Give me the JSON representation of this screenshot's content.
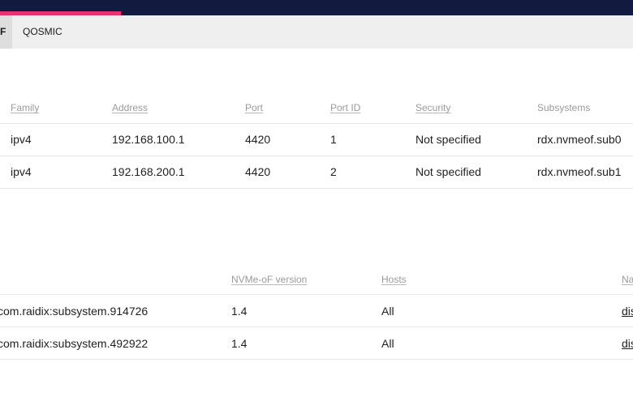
{
  "tabs": {
    "active_label": "F",
    "qos_label": "QOSMIC"
  },
  "ports_table": {
    "headers": [
      "Family",
      "Address",
      "Port",
      "Port ID",
      "Security",
      "Subsystems"
    ],
    "rows": [
      [
        "ipv4",
        "192.168.100.1",
        "4420",
        "1",
        "Not specified",
        "rdx.nvmeof.sub0"
      ],
      [
        "ipv4",
        "192.168.200.1",
        "4420",
        "2",
        "Not specified",
        "rdx.nvmeof.sub1"
      ]
    ]
  },
  "subsystems_table": {
    "headers": [
      "NVMe-oF version",
      "Hosts",
      "Na"
    ],
    "rows": [
      [
        "com.raidix:subsystem.914726",
        "1.4",
        "All",
        "dis"
      ],
      [
        "com.raidix:subsystem.492922",
        "1.4",
        "All",
        "dis"
      ]
    ]
  },
  "colors": {
    "topbar": "#121a3f",
    "accent": "#e8336f",
    "tabbar": "#efefef"
  }
}
